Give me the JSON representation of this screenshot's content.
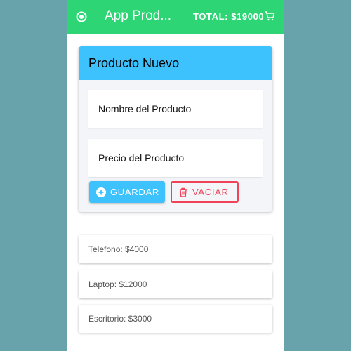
{
  "toolbar": {
    "title": "App Prod...",
    "total_label": "TOTAL: $19000",
    "menu_icon": "circle-dot-icon",
    "cart_icon": "cart-icon",
    "color": "#2ed575"
  },
  "form": {
    "header": "Producto Nuevo",
    "name_placeholder": "Nombre del Producto",
    "price_placeholder": "Precio del Producto",
    "save_label": "GUARDAR",
    "clear_label": "VACIAR",
    "header_color": "#3dc2fe",
    "danger_color": "#f0435a"
  },
  "products": [
    {
      "text": "Telefono: $4000"
    },
    {
      "text": "Laptop: $12000"
    },
    {
      "text": "Escritorio: $3000"
    }
  ]
}
